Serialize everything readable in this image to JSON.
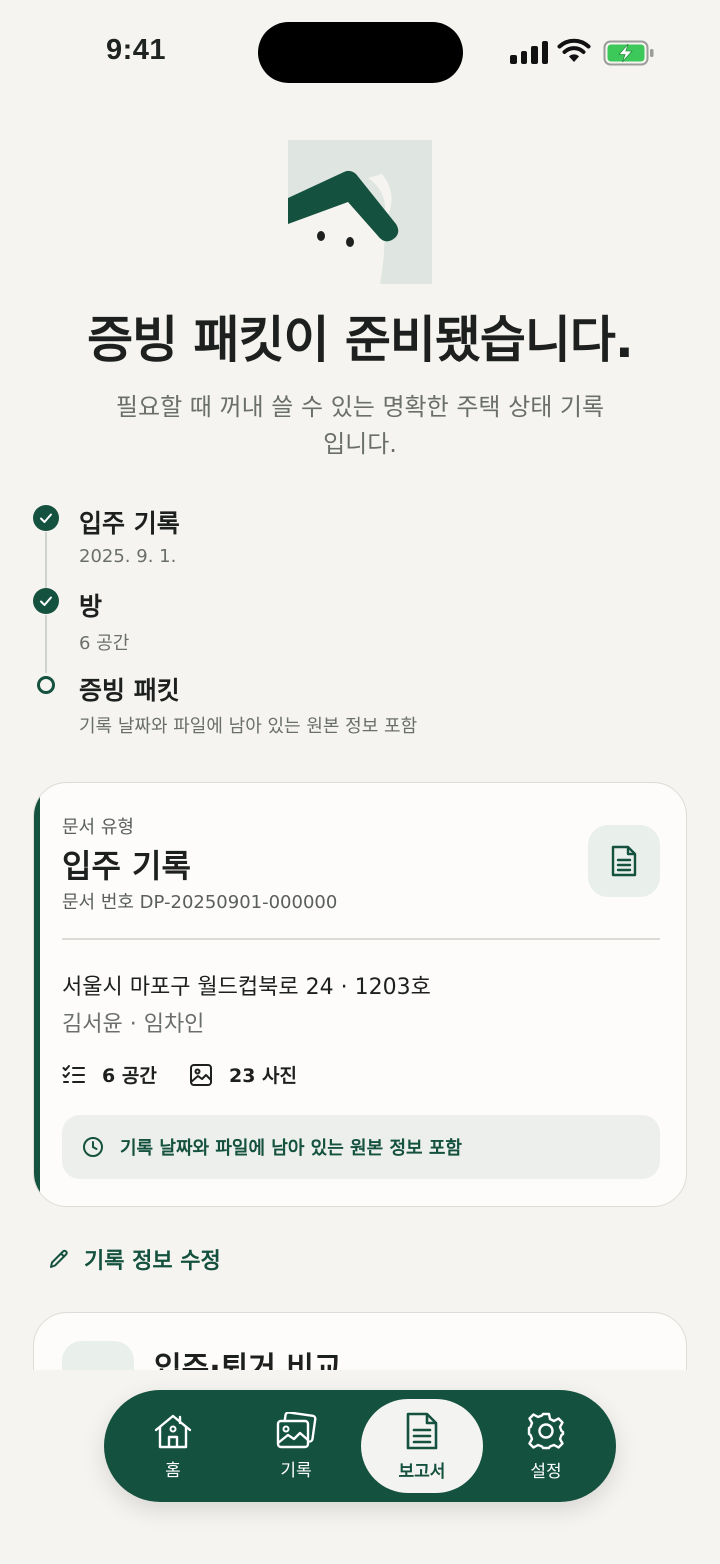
{
  "status_bar": {
    "time": "9:41"
  },
  "hero": {
    "headline": "증빙 패킷이 준비됐습니다.",
    "subtitle": "필요할 때 꺼내 쓸 수 있는 명확한 주택 상태 기록입니다."
  },
  "timeline": [
    {
      "title": "입주 기록",
      "sub": "2025. 9. 1.",
      "state": "done"
    },
    {
      "title": "방",
      "sub": "6 공간",
      "state": "done"
    },
    {
      "title": "증빙 패킷",
      "sub": "기록 날짜와 파일에 남아 있는 원본 정보 포함",
      "state": "current"
    }
  ],
  "card": {
    "doc_type_label": "문서 유형",
    "doc_title": "입주 기록",
    "doc_number": "문서 번호 DP-20250901-000000",
    "address": "서울시 마포구 월드컵북로 24 · 1203호",
    "people": "김서윤 · 임차인",
    "stats": {
      "spaces": "6 공간",
      "photos": "23 사진"
    },
    "info": "기록 날짜와 파일에 남아 있는 원본 정보 포함"
  },
  "edit_link": "기록 정보 수정",
  "card2": {
    "title": "입주·퇴거 비교"
  },
  "nav": [
    {
      "label": "홈",
      "icon": "house-icon"
    },
    {
      "label": "기록",
      "icon": "photos-icon"
    },
    {
      "label": "보고서",
      "icon": "document-icon",
      "active": true
    },
    {
      "label": "설정",
      "icon": "gear-icon"
    }
  ],
  "colors": {
    "accent": "#15513f",
    "background": "#f5f4f0",
    "battery": "#3dc85a"
  }
}
